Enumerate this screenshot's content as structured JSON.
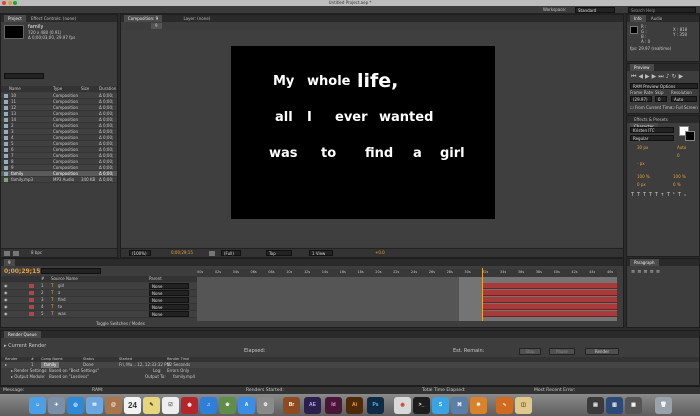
{
  "window": {
    "title": "Untitled Project.aep *",
    "workspace_label": "Workspace:",
    "workspace_value": "Standard",
    "search_placeholder": "Search Help"
  },
  "project": {
    "tabs": [
      "Project",
      "Effect Controls: (none)"
    ],
    "selected_name": "family",
    "selected_info1": "720 x 480 (0.91)",
    "selected_info2": "Δ 0;00;03;00, 29.97 fps",
    "search_placeholder": "",
    "columns": [
      "Name",
      "Type",
      "Size",
      "Duration"
    ],
    "items": [
      {
        "name": "10",
        "type": "Composition",
        "size": "",
        "dur": "Δ 0;00;"
      },
      {
        "name": "11",
        "type": "Composition",
        "size": "",
        "dur": "Δ 0;00;"
      },
      {
        "name": "12",
        "type": "Composition",
        "size": "",
        "dur": "Δ 0;00;"
      },
      {
        "name": "13",
        "type": "Composition",
        "size": "",
        "dur": "Δ 0;00;"
      },
      {
        "name": "14",
        "type": "Composition",
        "size": "",
        "dur": "Δ 0;00;"
      },
      {
        "name": "2",
        "type": "Composition",
        "size": "",
        "dur": "Δ 0;00;"
      },
      {
        "name": "3",
        "type": "Composition",
        "size": "",
        "dur": "Δ 0;00;"
      },
      {
        "name": "4",
        "type": "Composition",
        "size": "",
        "dur": "Δ 0;00;"
      },
      {
        "name": "5",
        "type": "Composition",
        "size": "",
        "dur": "Δ 0;00;"
      },
      {
        "name": "6",
        "type": "Composition",
        "size": "",
        "dur": "Δ 0;00;"
      },
      {
        "name": "7",
        "type": "Composition",
        "size": "",
        "dur": "Δ 0;00;"
      },
      {
        "name": "8",
        "type": "Composition",
        "size": "",
        "dur": "Δ 0;00;"
      },
      {
        "name": "9",
        "type": "Composition",
        "size": "",
        "dur": "Δ 0;00;"
      },
      {
        "name": "family",
        "type": "Composition",
        "size": "",
        "dur": "Δ 0;00;"
      },
      {
        "name": "family.mp3",
        "type": "MP3 Audio",
        "size": "340 KB",
        "dur": "Δ 0;00;"
      }
    ],
    "footer_bpc": "8 bpc"
  },
  "composition": {
    "tabs": [
      "Composition: 9",
      "Layer: (none)"
    ],
    "subtab": "9",
    "lines": [
      [
        {
          "w": "My",
          "big": false
        },
        {
          "w": "whole",
          "big": false
        },
        {
          "w": "life,",
          "big": true
        }
      ],
      [
        {
          "w": "all",
          "big": false
        },
        {
          "w": "I",
          "big": false
        },
        {
          "w": "ever",
          "big": false
        },
        {
          "w": "wanted",
          "big": false
        }
      ],
      [
        {
          "w": "was",
          "big": false
        },
        {
          "w": "to",
          "big": false
        },
        {
          "w": "find",
          "big": false
        },
        {
          "w": "a",
          "big": false
        },
        {
          "w": "girl",
          "big": false
        }
      ]
    ],
    "footer": {
      "zoom": "(100%)",
      "timecode": "0;00;29;15",
      "resolution": "(Full)",
      "view": "Top",
      "views": "1 View",
      "offset": "+0.0"
    }
  },
  "info_panel": {
    "tabs": [
      "Info",
      "Audio"
    ],
    "r": "R :",
    "g": "G :",
    "b": "B :",
    "a": "A : 0",
    "x": "X : 818",
    "y": "Y : 358",
    "fps": "fps: 29.97 (realtime)"
  },
  "preview_panel": {
    "tab": "Preview",
    "options": "RAM Preview Options",
    "frame_rate_label": "Frame Rate",
    "skip_label": "Skip",
    "resolution_label": "Resolution",
    "frame_rate": "(29.97)",
    "skip": "0",
    "resolution": "Auto",
    "from_current": "From Current Time",
    "full_screen": "Full Screen"
  },
  "effects_panel": {
    "tabs": [
      "Effects & Presets",
      "Character"
    ],
    "font": "Kristen ITC",
    "style": "Regular",
    "size": "30 px",
    "leading": "Auto",
    "kerning": "",
    "tracking": "0",
    "stroke": "- px",
    "vscale": "100 %",
    "hscale": "100 %",
    "baseline": "0 px",
    "tsume": "0 %"
  },
  "paragraph_panel": {
    "tab": "Paragraph"
  },
  "timeline": {
    "tab": "9",
    "timecode": "0;00;29;15",
    "search_placeholder": "",
    "columns": [
      "#",
      "Source Name",
      "Parent"
    ],
    "layers": [
      {
        "num": "1",
        "name": "girl",
        "parent": "None"
      },
      {
        "num": "2",
        "name": "a",
        "parent": "None"
      },
      {
        "num": "3",
        "name": "find",
        "parent": "None"
      },
      {
        "num": "4",
        "name": "to",
        "parent": "None"
      },
      {
        "num": "5",
        "name": "was",
        "parent": "None"
      }
    ],
    "ruler": [
      "00s",
      "02s",
      "04s",
      "06s",
      "08s",
      "10s",
      "12s",
      "14s",
      "16s",
      "18s",
      "20s",
      "22s",
      "24s",
      "26s",
      "28s",
      "30s",
      "32s",
      "34s",
      "36s",
      "38s",
      "40s",
      "42s",
      "44s",
      "46s"
    ],
    "toggle_label": "Toggle Switches / Modes"
  },
  "render_queue": {
    "tab": "Render Queue",
    "current_render": "Current Render",
    "elapsed": "Elapsed:",
    "est_remain": "Est. Remain:",
    "stop": "Stop",
    "pause": "Pause",
    "render": "Render",
    "columns": [
      "Render",
      "#",
      "Comp Name",
      "Status",
      "Started",
      "Render Time"
    ],
    "item": {
      "num": "1",
      "comp": "family",
      "status": "Done",
      "started": "Fri, Ma... 12, 12:33:32 PM",
      "time": "52 Seconds"
    },
    "render_settings_label": "Render Settings:",
    "render_settings": "Based on \"Best Settings\"",
    "output_module_label": "Output Module:",
    "output_module": "Based on \"Lossless\"",
    "log_label": "Log:",
    "log": "Errors Only",
    "output_to_label": "Output To:",
    "output_to": "family.mp4"
  },
  "status_bar": {
    "message": "Message:",
    "ram": "RAM:",
    "renders_started": "Renders Started:",
    "total_time": "Total Time Elapsed:",
    "recent_error": "Most Recent Error:"
  },
  "dock": {
    "calendar_date": "24",
    "items": [
      "Finder",
      "Launchpad",
      "Safari",
      "Mail",
      "Contacts",
      "Calendar",
      "Notes",
      "Reminders",
      "Photo Booth",
      "iTunes",
      "iPhoto",
      "App Store",
      "Preferences",
      "Bridge",
      "After Effects",
      "InDesign",
      "Illustrator",
      "Photoshop",
      "Chrome",
      "Terminal",
      "Skype",
      "Network",
      "Firefox",
      "Grapher",
      "Preview",
      "Trash"
    ],
    "labels": {
      "br": "Br",
      "ae": "AE",
      "id": "Id",
      "ai": "Ai",
      "ps": "Ps"
    }
  }
}
